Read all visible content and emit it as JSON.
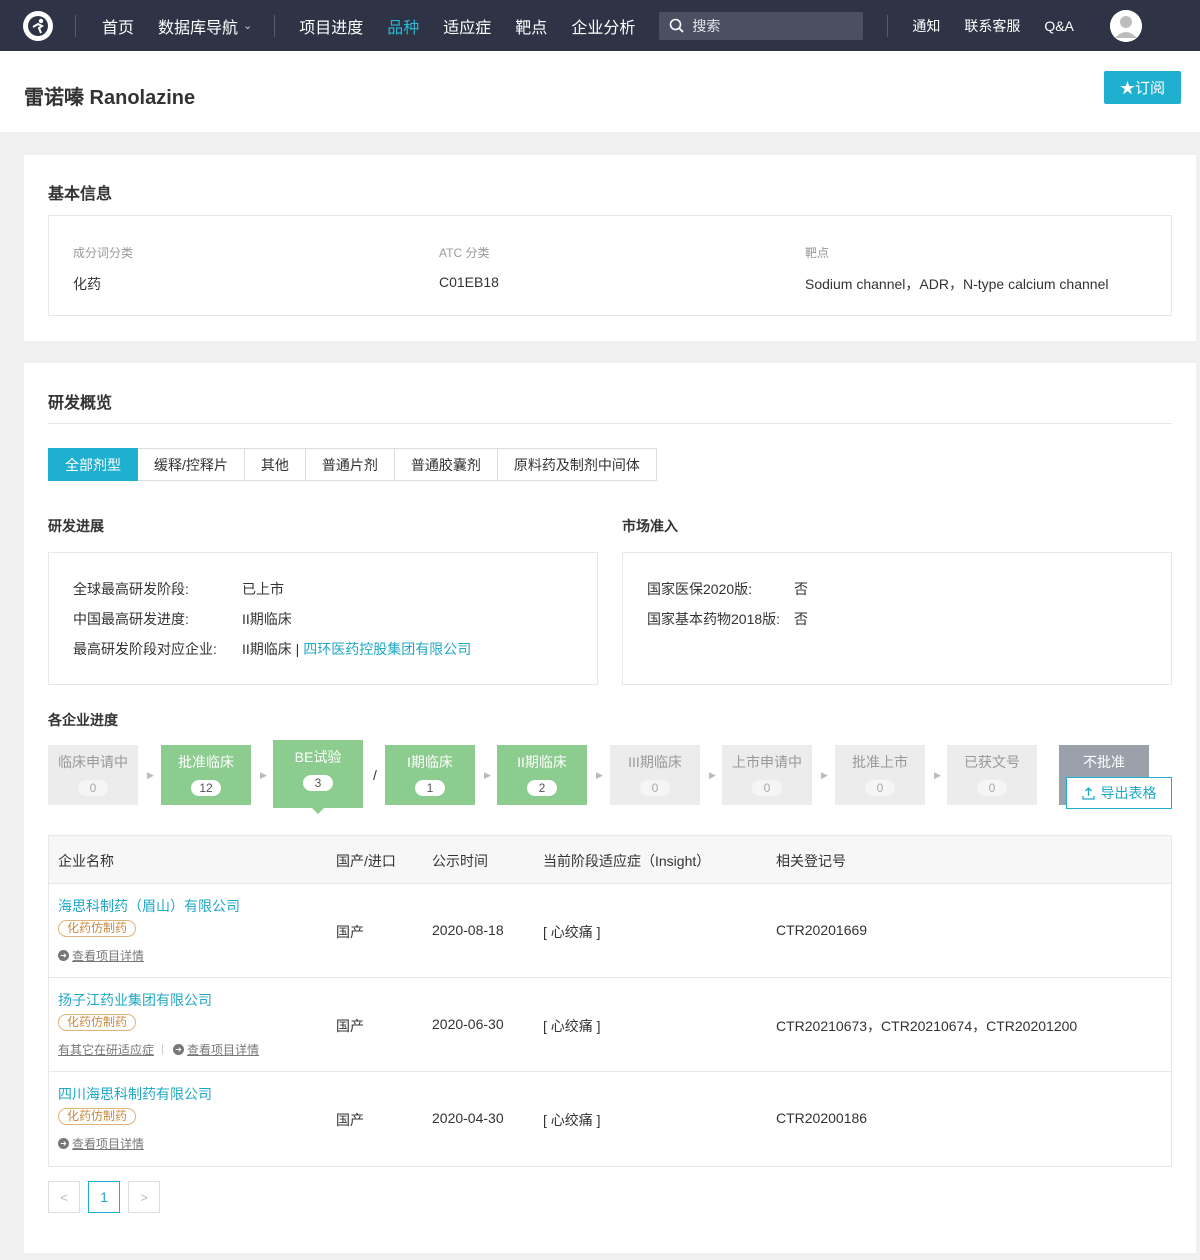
{
  "nav": {
    "logo_icon": "logo-icon",
    "items": [
      "首页",
      "数据库导航",
      "项目进度",
      "品种",
      "适应症",
      "靶点",
      "企业分析"
    ],
    "active": "品种",
    "search_placeholder": "搜索",
    "right": [
      "通知",
      "联系客服",
      "Q&A"
    ]
  },
  "header": {
    "title": "雷诺嗪 Ranolazine",
    "subscribe_label": "★订阅"
  },
  "basic": {
    "title": "基本信息",
    "fields": [
      {
        "label": "成分词分类",
        "value": "化药"
      },
      {
        "label": "ATC 分类",
        "value": "C01EB18"
      },
      {
        "label": "靶点",
        "value": "Sodium channel，ADR，N-type calcium channel"
      }
    ]
  },
  "overview": {
    "title": "研发概览",
    "tabs": [
      "全部剂型",
      "缓释/控释片",
      "其他",
      "普通片剂",
      "普通胶囊剂",
      "原料药及制剂中间体"
    ],
    "progress": {
      "title": "研发进展",
      "rows": [
        {
          "key": "全球最高研发阶段:",
          "value": "已上市"
        },
        {
          "key": "中国最高研发进度:",
          "value": "II期临床"
        },
        {
          "key": "最高研发阶段对应企业:",
          "value": "II期临床 | ",
          "link": "四环医药控股集团有限公司"
        }
      ]
    },
    "market": {
      "title": "市场准入",
      "rows": [
        {
          "key": "国家医保2020版:",
          "value": "否"
        },
        {
          "key": "国家基本药物2018版:",
          "value": "否"
        }
      ]
    },
    "company_progress": {
      "title": "各企业进度",
      "steps": [
        {
          "name": "临床申请中",
          "count": "0"
        },
        {
          "name": "批准临床",
          "count": "12"
        },
        {
          "name": "BE试验",
          "count": "3"
        },
        {
          "name": "I期临床",
          "count": "1"
        },
        {
          "name": "II期临床",
          "count": "2"
        },
        {
          "name": "III期临床",
          "count": "0"
        },
        {
          "name": "上市申请中",
          "count": "0"
        },
        {
          "name": "批准上市",
          "count": "0"
        },
        {
          "name": "已获文号",
          "count": "0"
        },
        {
          "name": "不批准",
          "count": ""
        }
      ],
      "separator": "/",
      "export_label": "导出表格"
    },
    "table": {
      "headers": [
        "企业名称",
        "国产/进口",
        "公示时间",
        "当前阶段适应症（Insight）",
        "相关登记号"
      ],
      "rows": [
        {
          "company": "海思科制药（眉山）有限公司",
          "tag": "化药仿制药",
          "other": "",
          "detail": "查看项目详情",
          "origin": "国产",
          "date": "2020-08-18",
          "indication": "[ 心绞痛 ]",
          "reg": "CTR20201669"
        },
        {
          "company": "扬子江药业集团有限公司",
          "tag": "化药仿制药",
          "other": "有其它在研适应症",
          "detail": "查看项目详情",
          "origin": "国产",
          "date": "2020-06-30",
          "indication": "[ 心绞痛 ]",
          "reg": "CTR20210673，CTR20210674，CTR20201200"
        },
        {
          "company": "四川海思科制药有限公司",
          "tag": "化药仿制药",
          "other": "",
          "detail": "查看项目详情",
          "origin": "国产",
          "date": "2020-04-30",
          "indication": "[ 心绞痛 ]",
          "reg": "CTR20200186"
        }
      ]
    },
    "pager": {
      "prev": "<",
      "current": "1",
      "next": ">"
    }
  }
}
